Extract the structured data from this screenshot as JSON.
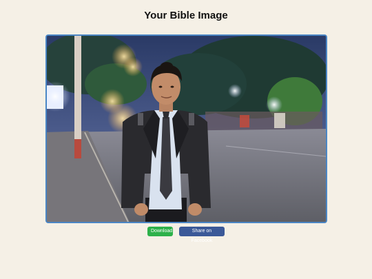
{
  "header": {
    "title": "Your Bible Image"
  },
  "image": {
    "content": "photo-young-man-in-suit-street-night"
  },
  "actions": {
    "download_label": "Download",
    "facebook_label": "Share on Facebook"
  },
  "colors": {
    "page_background": "#f5f0e6",
    "frame_border": "#4a86c5",
    "download_button": "#2db14a",
    "facebook_button": "#3b5998"
  }
}
